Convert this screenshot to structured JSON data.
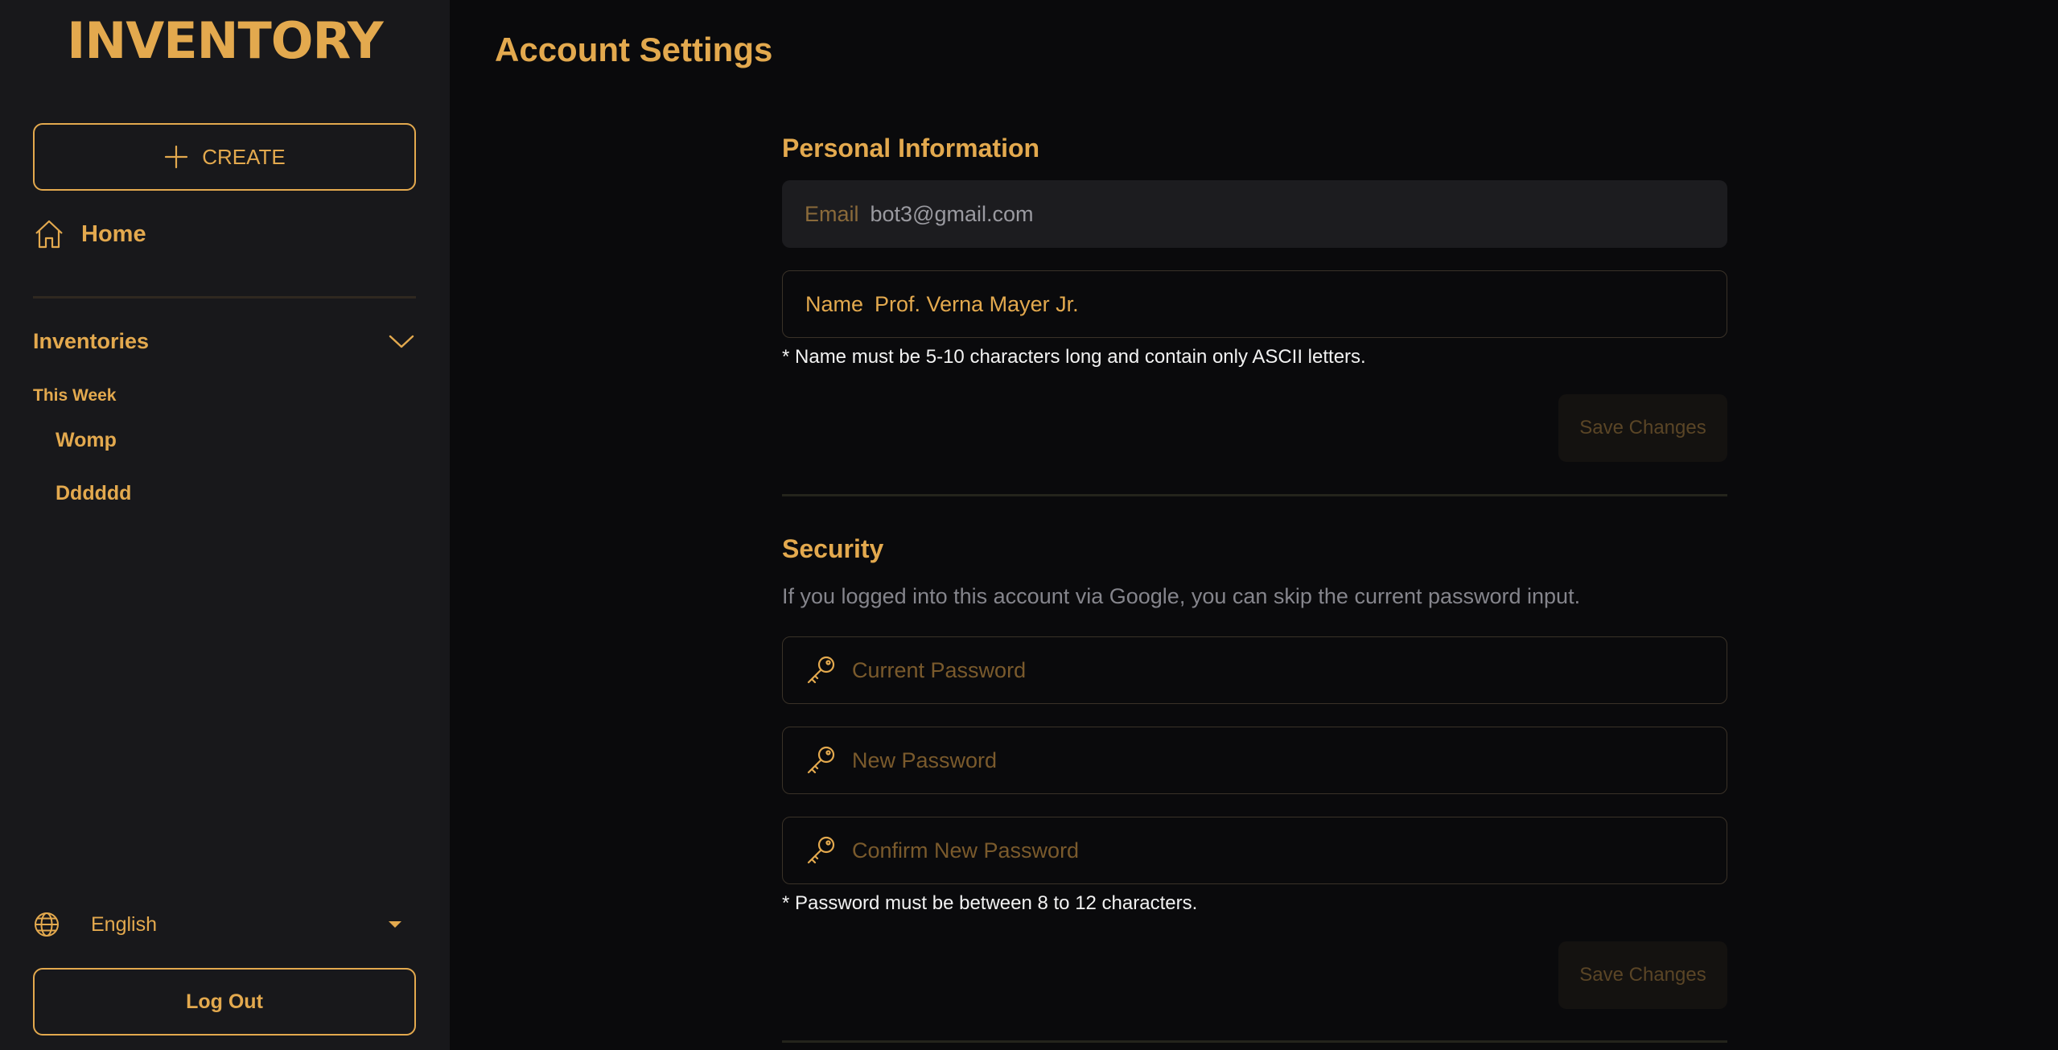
{
  "sidebar": {
    "logo": "INVENTORY",
    "create_label": "CREATE",
    "home_label": "Home",
    "inventories_label": "Inventories",
    "group_label": "This Week",
    "items": [
      "Womp",
      "Dddddd"
    ],
    "language": "English",
    "logout_label": "Log Out"
  },
  "main": {
    "title": "Account Settings",
    "personal": {
      "title": "Personal Information",
      "email_label": "Email",
      "email_value": "bot3@gmail.com",
      "name_label": "Name",
      "name_value": "Prof. Verna Mayer Jr.",
      "name_hint": "* Name must be 5-10 characters long and contain only ASCII letters.",
      "save_label": "Save Changes"
    },
    "security": {
      "title": "Security",
      "note": "If you logged into this account via Google, you can skip the current password input.",
      "current_placeholder": "Current Password",
      "new_placeholder": "New Password",
      "confirm_placeholder": "Confirm New Password",
      "password_hint": "* Password must be between 8 to 12 characters.",
      "save_label": "Save Changes"
    }
  },
  "colors": {
    "accent": "#e3a94e",
    "sidebar_bg": "#18181b",
    "main_bg": "#0a0a0c"
  }
}
